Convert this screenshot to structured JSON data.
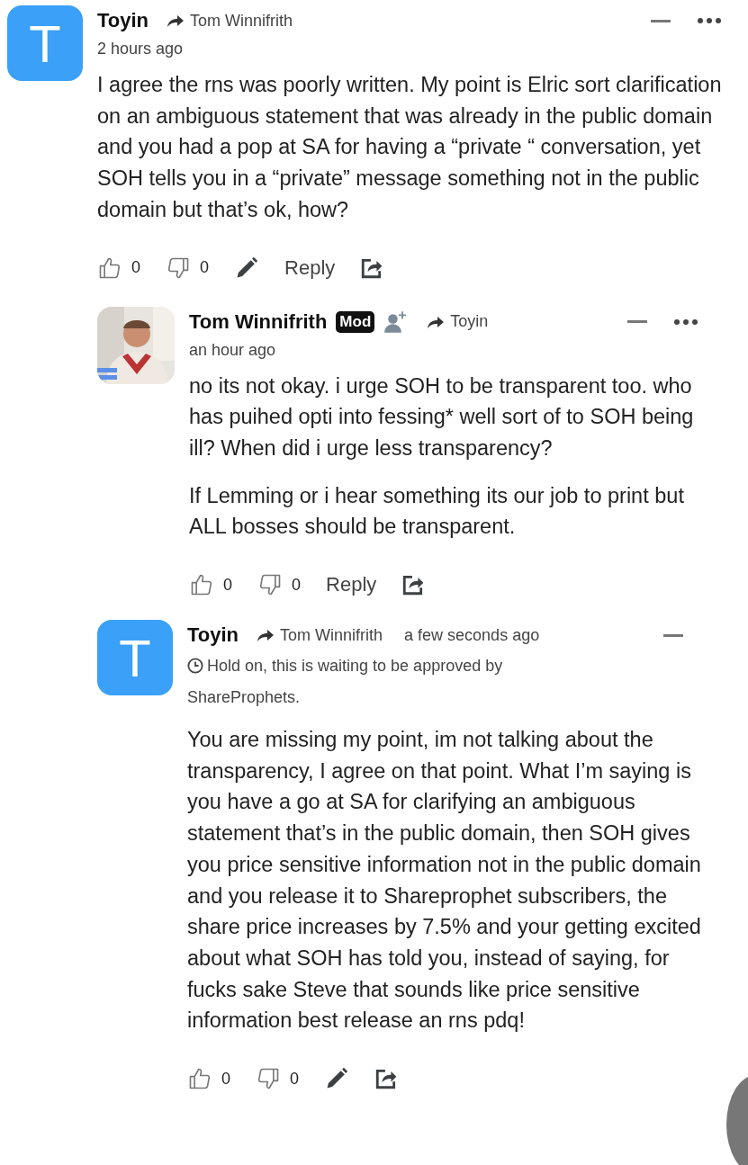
{
  "comments": [
    {
      "author": "Toyin",
      "reply_to": "Tom Winnifrith",
      "time": "2 hours ago",
      "avatar": {
        "kind": "letter",
        "letter": "T"
      },
      "menu": true,
      "paragraphs": [
        "I agree the rns was poorly written. My point is Elric sort clarification on an ambiguous statement that was already in the public domain and you had a pop at SA for having a “private “ conversation, yet SOH tells you in a “private” message something not in the public domain but that’s ok, how?"
      ],
      "actions": [
        {
          "kind": "like",
          "count": "0"
        },
        {
          "kind": "dislike",
          "count": "0"
        },
        {
          "kind": "edit"
        },
        {
          "kind": "reply",
          "label": "Reply"
        },
        {
          "kind": "share"
        }
      ],
      "children": [
        {
          "author": "Tom Winnifrith",
          "badge": "Mod",
          "follow": true,
          "reply_to": "Toyin",
          "time": "an hour ago",
          "avatar": {
            "kind": "picture"
          },
          "menu": true,
          "paragraphs": [
            "no its not okay. i urge SOH to be transparent too. who has puihed opti into fessing* well sort of to SOH being ill? When did i urge less transparency?",
            "If Lemming or i hear something its our job to print but ALL bosses should be transparent."
          ],
          "actions": [
            {
              "kind": "like",
              "count": "0"
            },
            {
              "kind": "dislike",
              "count": "0"
            },
            {
              "kind": "reply",
              "label": "Reply"
            },
            {
              "kind": "share"
            }
          ]
        },
        {
          "author": "Toyin",
          "reply_to": "Tom Winnifrith",
          "time": "a few seconds ago",
          "avatar": {
            "kind": "letter",
            "letter": "T"
          },
          "menu": false,
          "pending": "Hold on, this is waiting to be approved by ShareProphets.",
          "paragraphs": [
            "You are missing my point, im not talking about the transparency, I agree on that point. What I’m saying is you have a go at SA for clarifying an ambiguous statement that’s in the public domain, then SOH gives you price sensitive information not in the public domain and you release it to Shareprophet subscribers, the share price increases by 7.5% and your getting excited about what SOH has told you, instead of saying, for fucks sake Steve that sounds like price sensitive information best release an rns pdq!"
          ],
          "actions": [
            {
              "kind": "like",
              "count": "0"
            },
            {
              "kind": "dislike",
              "count": "0"
            },
            {
              "kind": "edit"
            },
            {
              "kind": "share"
            }
          ]
        }
      ]
    }
  ]
}
